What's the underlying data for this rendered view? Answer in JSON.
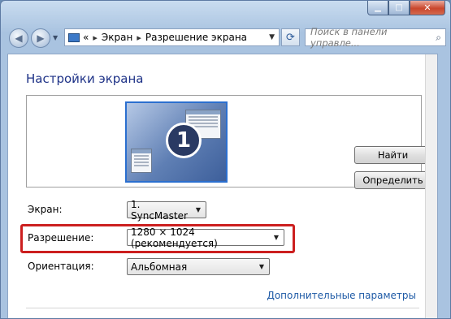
{
  "titlebar": {
    "min_label": "▁",
    "max_label": "□",
    "close_label": "✕"
  },
  "nav": {
    "breadcrumb_sep": "«",
    "breadcrumb": [
      "Экран",
      "Разрешение экрана"
    ],
    "search_placeholder": "Поиск в панели управле..."
  },
  "main": {
    "title": "Настройки экрана",
    "monitor_number": "1",
    "find_button": "Найти",
    "identify_button": "Определить",
    "screen_label": "Экран:",
    "screen_value": "1. SyncMaster",
    "resolution_label": "Разрешение:",
    "resolution_value": "1280 × 1024 (рекомендуется)",
    "orientation_label": "Ориентация:",
    "orientation_value": "Альбомная",
    "advanced_link": "Дополнительные параметры"
  },
  "colors": {
    "highlight": "#cc1f1f",
    "title": "#1e3287",
    "link": "#1e5aa6"
  }
}
